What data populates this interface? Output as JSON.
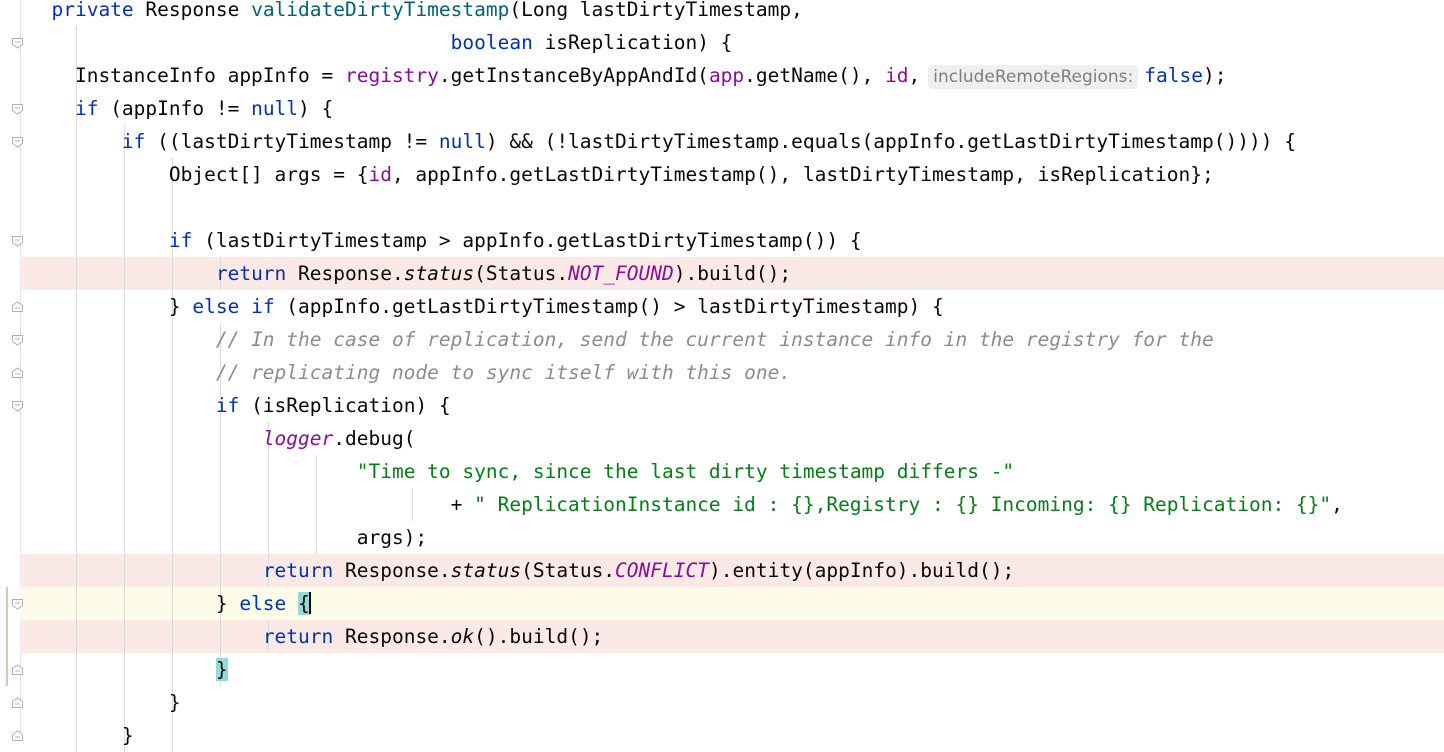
{
  "editor": {
    "lines": [
      [
        {
          "t": "  "
        },
        {
          "t": "private",
          "c": "kw"
        },
        {
          "t": " Response "
        },
        {
          "t": "validateDirtyTimestamp",
          "c": "fn"
        },
        {
          "t": "(Long lastDirtyTimestamp,"
        }
      ],
      [
        {
          "t": "                                    "
        },
        {
          "t": "boolean",
          "c": "kw"
        },
        {
          "t": " isReplication) {"
        }
      ],
      [
        {
          "t": "    InstanceInfo appInfo = "
        },
        {
          "t": "registry",
          "c": "fld"
        },
        {
          "t": ".getInstanceByAppAndId("
        },
        {
          "t": "app",
          "c": "fld"
        },
        {
          "t": ".getName(), "
        },
        {
          "t": "id",
          "c": "fld"
        },
        {
          "t": ","
        },
        {
          "t": "includeRemoteRegions:",
          "c": "hint"
        },
        {
          "t": "false",
          "c": "kw"
        },
        {
          "t": ");"
        }
      ],
      [
        {
          "t": "    "
        },
        {
          "t": "if",
          "c": "kw"
        },
        {
          "t": " (appInfo != "
        },
        {
          "t": "null",
          "c": "kw"
        },
        {
          "t": ") {"
        }
      ],
      [
        {
          "t": "        "
        },
        {
          "t": "if",
          "c": "kw"
        },
        {
          "t": " ((lastDirtyTimestamp != "
        },
        {
          "t": "null",
          "c": "kw"
        },
        {
          "t": ") && (!lastDirtyTimestamp.equals(appInfo.getLastDirtyTimestamp()))) {"
        }
      ],
      [
        {
          "t": "            Object[] args = {"
        },
        {
          "t": "id",
          "c": "fld"
        },
        {
          "t": ", appInfo.getLastDirtyTimestamp(), lastDirtyTimestamp, isReplication};"
        }
      ],
      [
        {
          "t": ""
        }
      ],
      [
        {
          "t": "            "
        },
        {
          "t": "if",
          "c": "kw"
        },
        {
          "t": " (lastDirtyTimestamp > appInfo.getLastDirtyTimestamp()) {"
        }
      ],
      [
        {
          "t": "                "
        },
        {
          "t": "return",
          "c": "kw"
        },
        {
          "t": " Response."
        },
        {
          "t": "status",
          "c": "st"
        },
        {
          "t": "(Status."
        },
        {
          "t": "NOT_FOUND",
          "c": "ifld"
        },
        {
          "t": ").build();"
        }
      ],
      [
        {
          "t": "            } "
        },
        {
          "t": "else if",
          "c": "kw"
        },
        {
          "t": " (appInfo.getLastDirtyTimestamp() > lastDirtyTimestamp) {"
        }
      ],
      [
        {
          "t": "                "
        },
        {
          "t": "// In the case of replication, send the current instance info in the registry for the",
          "c": "cm"
        }
      ],
      [
        {
          "t": "                "
        },
        {
          "t": "// replicating node to sync itself with this one.",
          "c": "cm"
        }
      ],
      [
        {
          "t": "                "
        },
        {
          "t": "if",
          "c": "kw"
        },
        {
          "t": " (isReplication) {"
        }
      ],
      [
        {
          "t": "                    "
        },
        {
          "t": "logger",
          "c": "ifld"
        },
        {
          "t": ".debug("
        }
      ],
      [
        {
          "t": "                            "
        },
        {
          "t": "\"Time to sync, since the last dirty timestamp differs -\"",
          "c": "str"
        }
      ],
      [
        {
          "t": "                                    + "
        },
        {
          "t": "\" ReplicationInstance id : {},Registry : {} Incoming: {} Replication: {}\"",
          "c": "str"
        },
        {
          "t": ","
        }
      ],
      [
        {
          "t": "                            args);"
        }
      ],
      [
        {
          "t": "                    "
        },
        {
          "t": "return",
          "c": "kw"
        },
        {
          "t": " Response."
        },
        {
          "t": "status",
          "c": "st"
        },
        {
          "t": "(Status."
        },
        {
          "t": "CONFLICT",
          "c": "ifld"
        },
        {
          "t": ").entity(appInfo).build();"
        }
      ],
      [
        {
          "t": "                } "
        },
        {
          "t": "else",
          "c": "kw"
        },
        {
          "t": " "
        },
        {
          "t": "{",
          "c": "brace-match"
        },
        {
          "t": "",
          "c": "caret"
        }
      ],
      [
        {
          "t": "                    "
        },
        {
          "t": "return",
          "c": "kw"
        },
        {
          "t": " Response."
        },
        {
          "t": "ok",
          "c": "st"
        },
        {
          "t": "().build();"
        }
      ],
      [
        {
          "t": "                "
        },
        {
          "t": "}",
          "c": "brace-match"
        }
      ],
      [
        {
          "t": "            }"
        }
      ],
      [
        {
          "t": "        }"
        }
      ]
    ],
    "error_lines": [
      8,
      17,
      19
    ],
    "current_line": 18,
    "fold_markers": [
      {
        "line": 1,
        "kind": "start"
      },
      {
        "line": 3,
        "kind": "start"
      },
      {
        "line": 4,
        "kind": "start"
      },
      {
        "line": 7,
        "kind": "start"
      },
      {
        "line": 9,
        "kind": "end"
      },
      {
        "line": 10,
        "kind": "start"
      },
      {
        "line": 11,
        "kind": "end"
      },
      {
        "line": 12,
        "kind": "start"
      },
      {
        "line": 18,
        "kind": "start"
      },
      {
        "line": 20,
        "kind": "end"
      },
      {
        "line": 21,
        "kind": "end"
      },
      {
        "line": 22,
        "kind": "end"
      }
    ]
  }
}
